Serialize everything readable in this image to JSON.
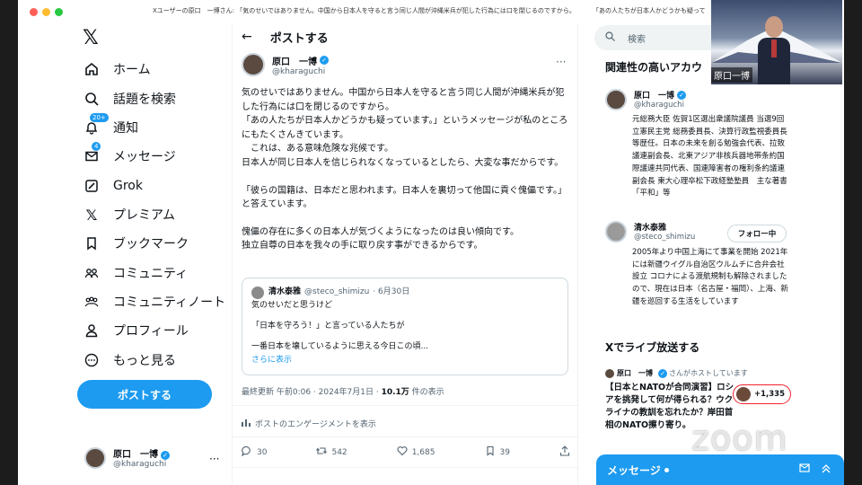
{
  "window": {
    "title_left": "Xユーザーの原口　一博さん: 「気のせいではありません。中国から日本人を守ると言う同じ人間が沖縄米兵が犯した行為には口を閉じるのですから。",
    "title_right": "「あの人たちが日本人かどうかも疑って"
  },
  "nav": {
    "items": [
      {
        "label": "ホーム",
        "icon": "home-icon"
      },
      {
        "label": "話題を検索",
        "icon": "search-icon"
      },
      {
        "label": "通知",
        "icon": "bell-icon",
        "badge": "20+"
      },
      {
        "label": "メッセージ",
        "icon": "mail-icon",
        "badge": "4"
      },
      {
        "label": "Grok",
        "icon": "grok-icon"
      },
      {
        "label": "プレミアム",
        "icon": "x-icon"
      },
      {
        "label": "ブックマーク",
        "icon": "bookmark-icon"
      },
      {
        "label": "コミュニティ",
        "icon": "community-icon"
      },
      {
        "label": "コミュニティノート",
        "icon": "community-notes-icon"
      },
      {
        "label": "プロフィール",
        "icon": "profile-icon"
      },
      {
        "label": "もっと見る",
        "icon": "more-icon"
      }
    ],
    "post_button": "ポストする",
    "me": {
      "name": "原口　一博",
      "handle": "@kharaguchi"
    }
  },
  "post": {
    "header_title": "ポストする",
    "author_name": "原口　一博",
    "author_handle": "@kharaguchi",
    "paragraphs": [
      "気のせいではありません。中国から日本人を守ると言う同じ人間が沖縄米兵が犯した行為には口を閉じるのですから。\n「あの人たちが日本人かどうかも疑っています。」というメッセージが私のところにもたくさんきています。\n　これは、ある意味危険な兆候です。\n日本人が同じ日本人を信じられなくなっているとしたら、大変な事だからです。",
      "「彼らの国籍は、日本だと思われます。日本人を裏切って他国に貢ぐ傀儡です。」と答えています。",
      "傀儡の存在に多くの日本人が気づくようになったのは良い傾向です。\n独立自尊の日本を我々の手に取り戻す事ができるからです。"
    ],
    "quote": {
      "name": "清水泰雅",
      "handle": "@steco_shimizu",
      "date": "· 6月30日",
      "lines": [
        "気のせいだと思うけど",
        "",
        "「日本を守ろう！」と言っている人たちが",
        "",
        "一番日本を壊しているように思える今日この頃..."
      ],
      "more": "さらに表示"
    },
    "meta_time": "最終更新 午前0:06 · 2024年7月1日 · ",
    "meta_views": "10.1万",
    "meta_views_suffix": " 件の表示",
    "engagement": "ポストのエンゲージメントを表示",
    "actions": {
      "replies": "30",
      "reposts": "542",
      "likes": "1,685",
      "bookmarks": "39"
    }
  },
  "sidebar": {
    "search_placeholder": "検索",
    "related_title": "関連性の高いアカウ",
    "users": [
      {
        "name": "原口　一博",
        "handle": "@kharaguchi",
        "bio": "元総務大臣 佐賀1区選出衆議院議員 当選9回 立憲民主党 総務委員長、決算行政監視委員長等歴任。日本の未来を創る勉強会代表、拉致議連副会長、北東アジア非核兵器地帯条約国際議連共同代表、国連障害者の権利条約議連副会長 東大心理卒松下政経塾塾員　主な著書「平和」等"
      },
      {
        "name": "清水泰雅",
        "handle": "@steco_shimizu",
        "bio": "2005年より中国上海にて事業を開始 2021年には新疆ウイグル自治区ウルムチに合弁会社設立 コロナによる渡航規制も解除されましたので、現在は日本（名古屋・福岡）、上海、新疆を巡回する生活をしています",
        "follow": "フォロー中"
      }
    ],
    "live_title": "Xでライブ放送する",
    "live_host_name": "原口　一博",
    "live_host_suffix": "さんがホストしています",
    "live_text": "【日本とNATOが合同演習】ロシアを挑発して何が得られる？ウクライナの教訓を忘れたか？岸田首相のNATO擦り寄り。",
    "live_count": "+1,335"
  },
  "messages_drawer": {
    "label": "メッセージ"
  },
  "video": {
    "name": "原口一博"
  },
  "watermark": "zoom",
  "colors": {
    "accent": "#1d9bf0",
    "text": "#0f1419",
    "muted": "#536471"
  }
}
